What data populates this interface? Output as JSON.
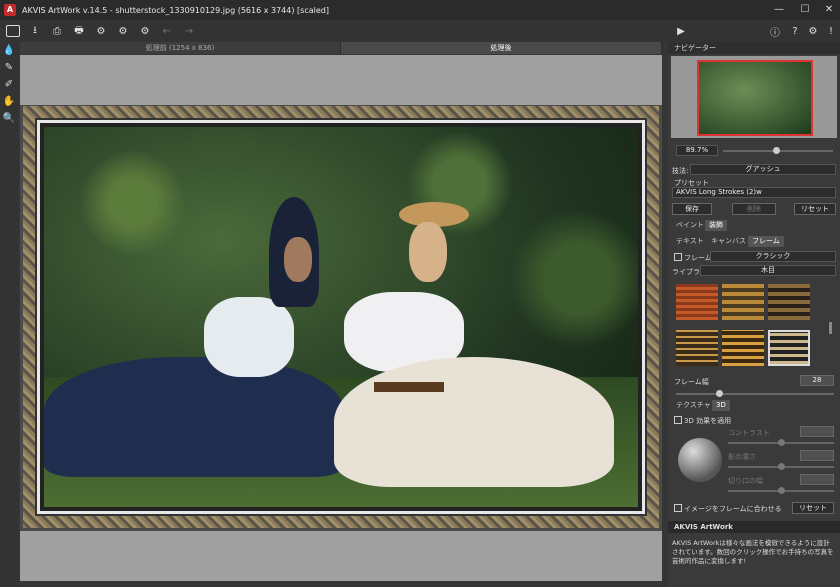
{
  "window": {
    "title": "AKVIS ArtWork v.14.5 - shutterstock_1330910129.jpg (5616 x 3744) [scaled]",
    "minimize": "—",
    "maximize": "☐",
    "close": "✕"
  },
  "canvas_tabs": {
    "before": "処理前 (1254 x 836)",
    "after": "処理後"
  },
  "navigator": {
    "title": "ナビゲーター",
    "zoom": "89.7%"
  },
  "method": {
    "label": "技法:",
    "value": "グアッシュ"
  },
  "preset": {
    "label": "プリセット",
    "value": "AKVIS Long Strokes (2)w",
    "save": "保存",
    "delete": "削除",
    "reset": "リセット"
  },
  "main_tabs": [
    "ペイント",
    "装飾"
  ],
  "sub_tabs": [
    "テキスト",
    "キャンバス",
    "フレーム"
  ],
  "frame": {
    "checkbox_label": "フレーム",
    "type": "クラシック",
    "library_label": "ライブラリ",
    "library": "木目",
    "width_label": "フレーム幅",
    "width": "28"
  },
  "texture_tabs": [
    "テクスチャ",
    "3D"
  ],
  "effect3d": {
    "checkbox_label": "3D 効果を適用",
    "brightness": "コントラスト",
    "roughness": "影の濃さ",
    "cut": "切り口の幅",
    "fit": "イメージをフレームに合わせる",
    "reset": "リセット"
  },
  "info": {
    "title": "AKVIS ArtWork",
    "text": "AKVIS ArtWorkは様々な画法を模倣できるように設計されています。数回のクリック操作でお手持ちの写真を芸術的作品に変換します!"
  }
}
